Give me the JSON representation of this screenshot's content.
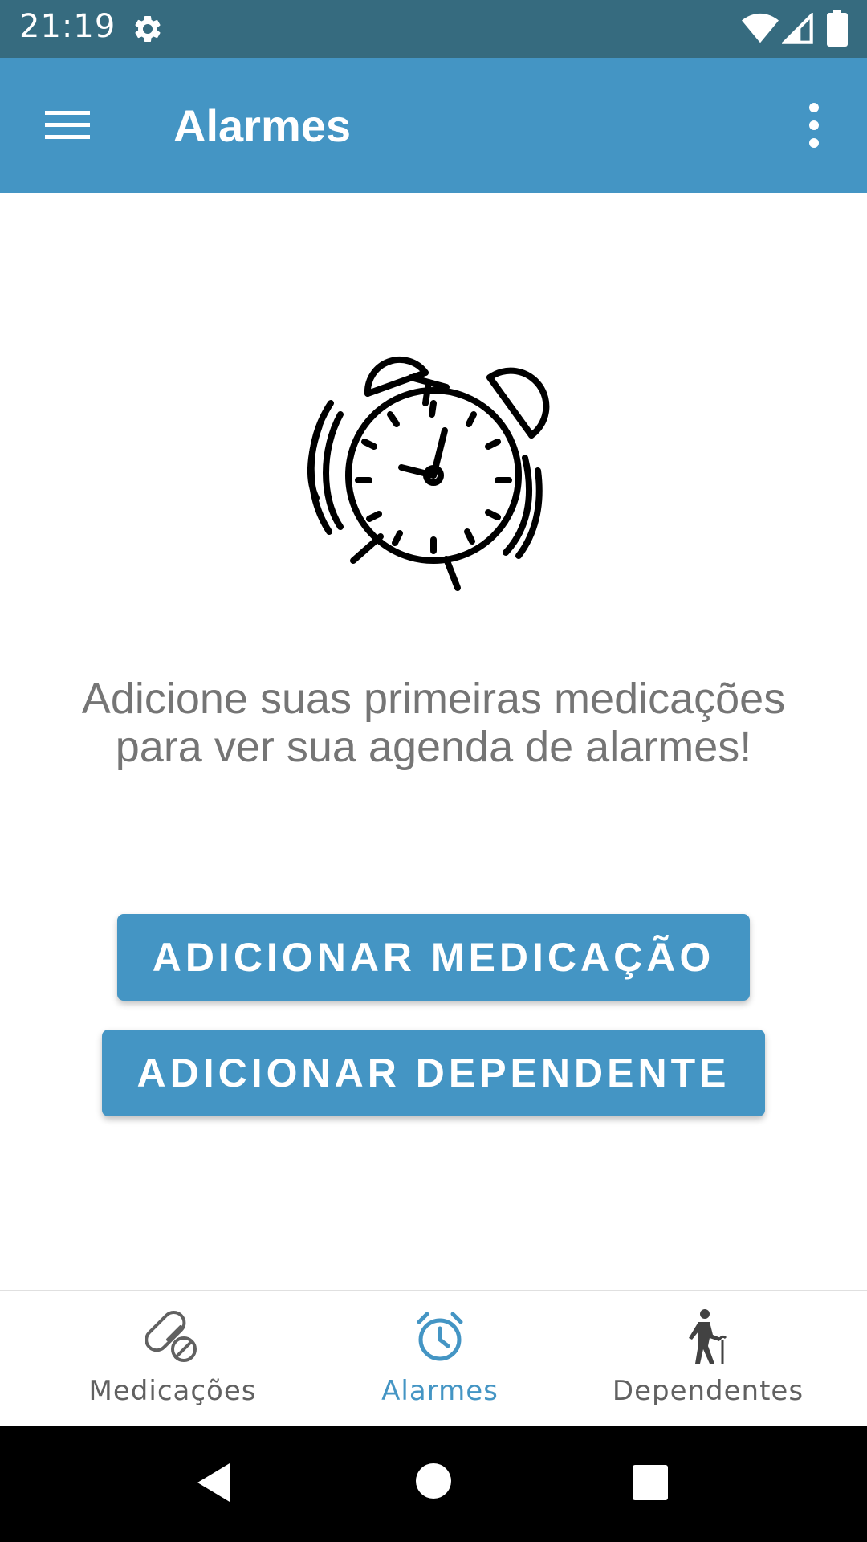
{
  "status_bar": {
    "time": "21:19",
    "icons": [
      "gear-icon",
      "wifi-icon",
      "signal-icon",
      "battery-icon"
    ]
  },
  "app_bar": {
    "title": "Alarmes",
    "color": "#4495C4",
    "icons": [
      "menu-icon",
      "more-vert-icon"
    ]
  },
  "empty_state": {
    "icon": "alarm-clock-icon",
    "message": "Adicione suas primeiras medicações para ver sua agenda de alarmes!",
    "add_medication_label": "ADICIONAR MEDICAÇÃO",
    "add_dependent_label": "ADICIONAR DEPENDENTE"
  },
  "bottom_nav": {
    "active": "Alarmes",
    "active_color": "#4495C4",
    "items": [
      {
        "label": "Medicações",
        "icon": "pill-icon"
      },
      {
        "label": "Alarmes",
        "icon": "alarm-icon"
      },
      {
        "label": "Dependentes",
        "icon": "elderly-person-icon"
      }
    ]
  },
  "system_nav": {
    "icons": [
      "back-icon",
      "home-icon",
      "recents-icon"
    ]
  }
}
